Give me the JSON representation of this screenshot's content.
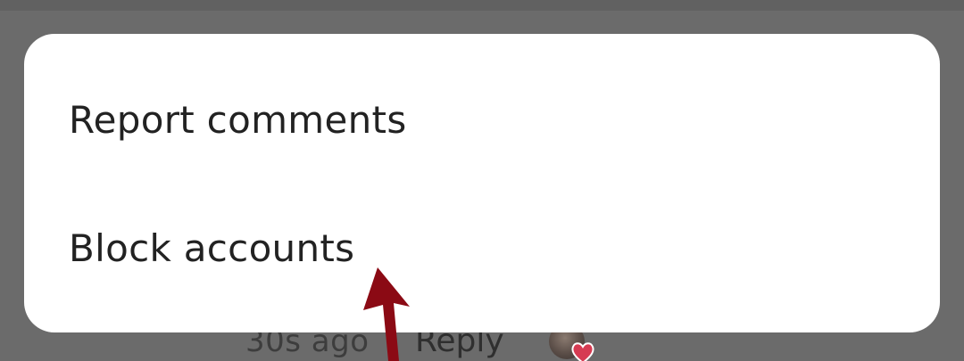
{
  "menu": {
    "items": [
      {
        "label": "Report comments"
      },
      {
        "label": "Block accounts"
      }
    ]
  },
  "comment_row": {
    "timestamp": "30s ago",
    "reply_label": "Reply"
  },
  "colors": {
    "overlay": "#6b6b6b",
    "sheet": "#ffffff",
    "text": "#222222",
    "annotation_arrow": "#8b0a14",
    "heart": "#d63b52"
  },
  "icons": {
    "annotation": "arrow-up-icon",
    "like": "heart-icon"
  }
}
